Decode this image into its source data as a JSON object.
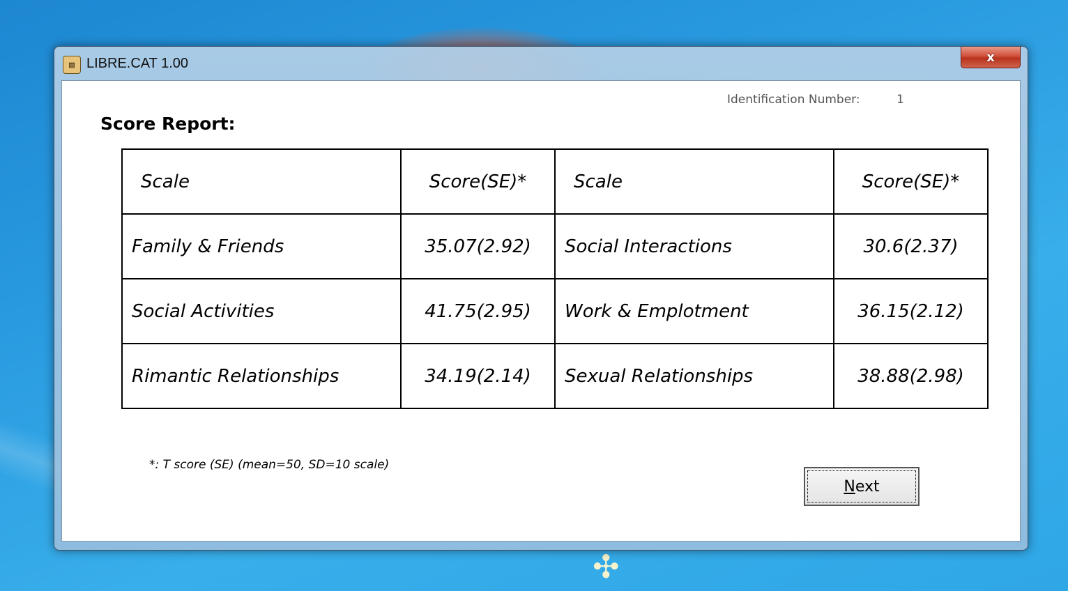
{
  "window": {
    "title": "LIBRE.CAT 1.00",
    "close_label": "x",
    "app_icon": "document-icon"
  },
  "identification": {
    "label": "Identification Number:",
    "value": "1"
  },
  "report": {
    "title": "Score Report:"
  },
  "table": {
    "headers": [
      "Scale",
      "Score(SE)*",
      "Scale",
      "Score(SE)*"
    ],
    "rows": [
      [
        "Family & Friends",
        "35.07(2.92)",
        "Social Interactions",
        "30.6(2.37)"
      ],
      [
        "Social Activities",
        "41.75(2.95)",
        "Work & Emplotment",
        "36.15(2.12)"
      ],
      [
        "Rimantic Relationships",
        "34.19(2.14)",
        "Sexual Relationships",
        "38.88(2.98)"
      ]
    ]
  },
  "footnote": "*: T score (SE) (mean=50, SD=10 scale)",
  "buttons": {
    "next_accel": "N",
    "next_rest": "ext"
  }
}
